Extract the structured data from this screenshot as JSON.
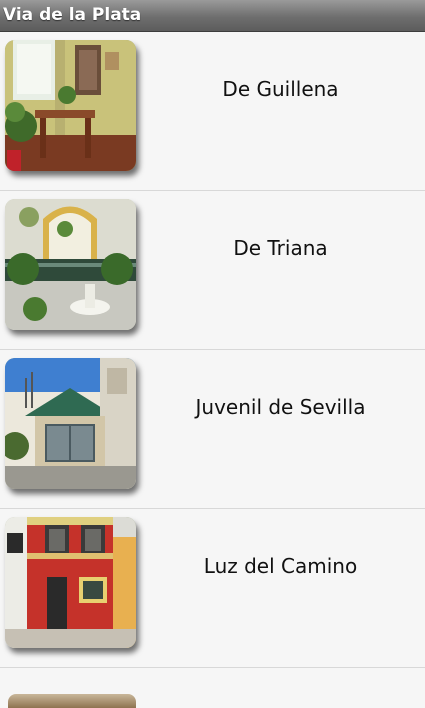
{
  "app": {
    "title": "Via de la Plata"
  },
  "list": {
    "items": [
      {
        "label": "De Guillena",
        "thumbnail": "interior-patio-icon"
      },
      {
        "label": "De Triana",
        "thumbnail": "courtyard-fountain-icon"
      },
      {
        "label": "Juvenil de Sevilla",
        "thumbnail": "hostel-building-icon"
      },
      {
        "label": "Luz del Camino",
        "thumbnail": "red-house-facade-icon"
      }
    ]
  },
  "colors": {
    "title_bar": "#6e6e6e",
    "row_background": "#f6f6f6",
    "divider": "#d8d8d8"
  }
}
